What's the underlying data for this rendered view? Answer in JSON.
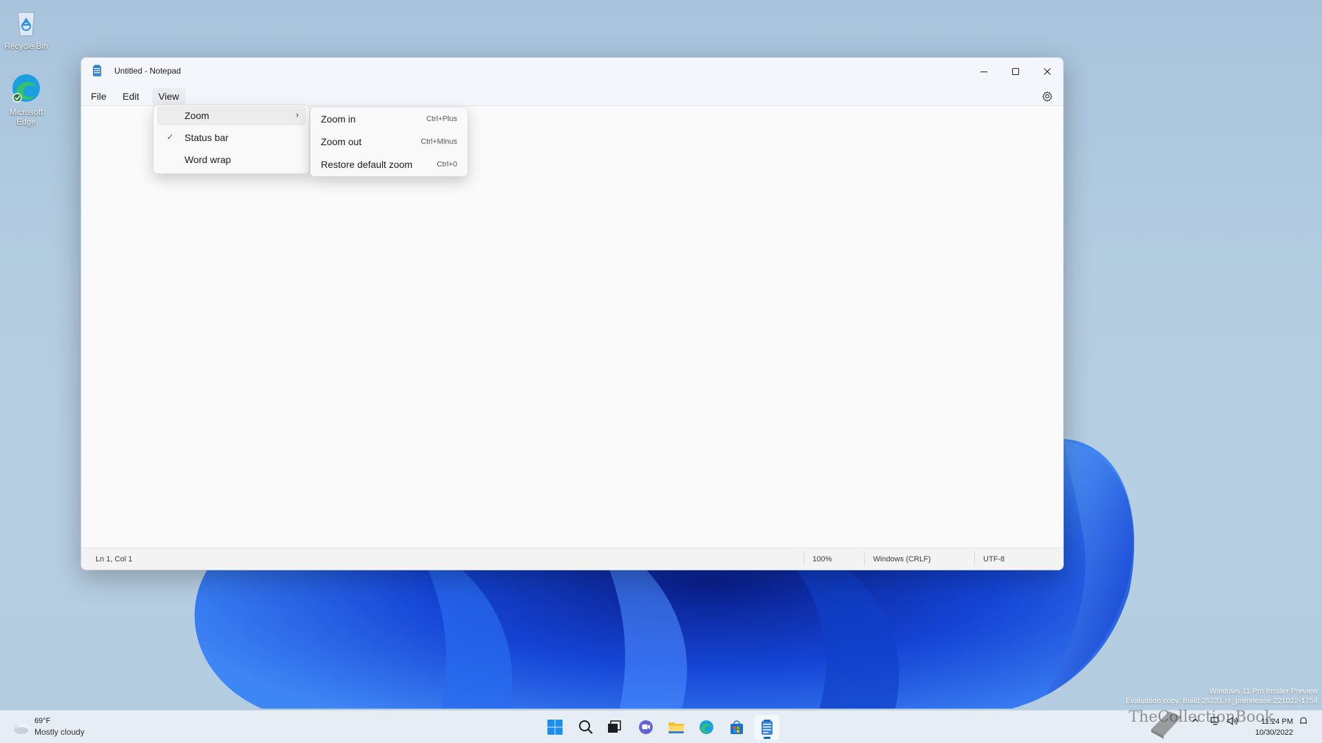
{
  "desktop": {
    "icons": [
      {
        "label": "Recycle Bin",
        "icon": "recycle-bin-icon"
      },
      {
        "label": "Microsoft Edge",
        "icon": "edge-icon"
      }
    ]
  },
  "window": {
    "title": "Untitled - Notepad",
    "controls": [
      "minimize-icon",
      "maximize-icon",
      "close-icon"
    ],
    "menubar": {
      "file": "File",
      "edit": "Edit",
      "view": "View",
      "active": "View"
    },
    "statusbar": {
      "position": "Ln 1, Col 1",
      "zoom": "100%",
      "line_endings": "Windows (CRLF)",
      "encoding": "UTF-8"
    }
  },
  "view_menu": {
    "items": [
      {
        "label": "Zoom",
        "has_submenu": true,
        "checked": false
      },
      {
        "label": "Status bar",
        "has_submenu": false,
        "checked": true
      },
      {
        "label": "Word wrap",
        "has_submenu": false,
        "checked": false
      }
    ]
  },
  "zoom_menu": {
    "items": [
      {
        "label": "Zoom in",
        "shortcut": "Ctrl+Plus"
      },
      {
        "label": "Zoom out",
        "shortcut": "Ctrl+Minus"
      },
      {
        "label": "Restore default zoom",
        "shortcut": "Ctrl+0"
      }
    ]
  },
  "watermark": {
    "line1": "Windows 11 Pro Insider Preview",
    "line2": "Evaluation copy. Build 25231.rs_prerelease.221022-1754"
  },
  "taskbar": {
    "weather": {
      "temp": "69°F",
      "status": "Mostly cloudy"
    },
    "apps": [
      "start-icon",
      "search-icon",
      "task-view-icon",
      "chat-icon",
      "file-explorer-icon",
      "edge-icon",
      "store-icon",
      "notepad-icon"
    ],
    "clock": {
      "time": "11:24 PM",
      "date": "10/30/2022"
    }
  },
  "overlay_watermark": "TheCollectionBook",
  "colors": {
    "accent": "#0067c0",
    "window_bg": "#f9f9f9",
    "titlebar_bg": "#f3f6fa"
  }
}
